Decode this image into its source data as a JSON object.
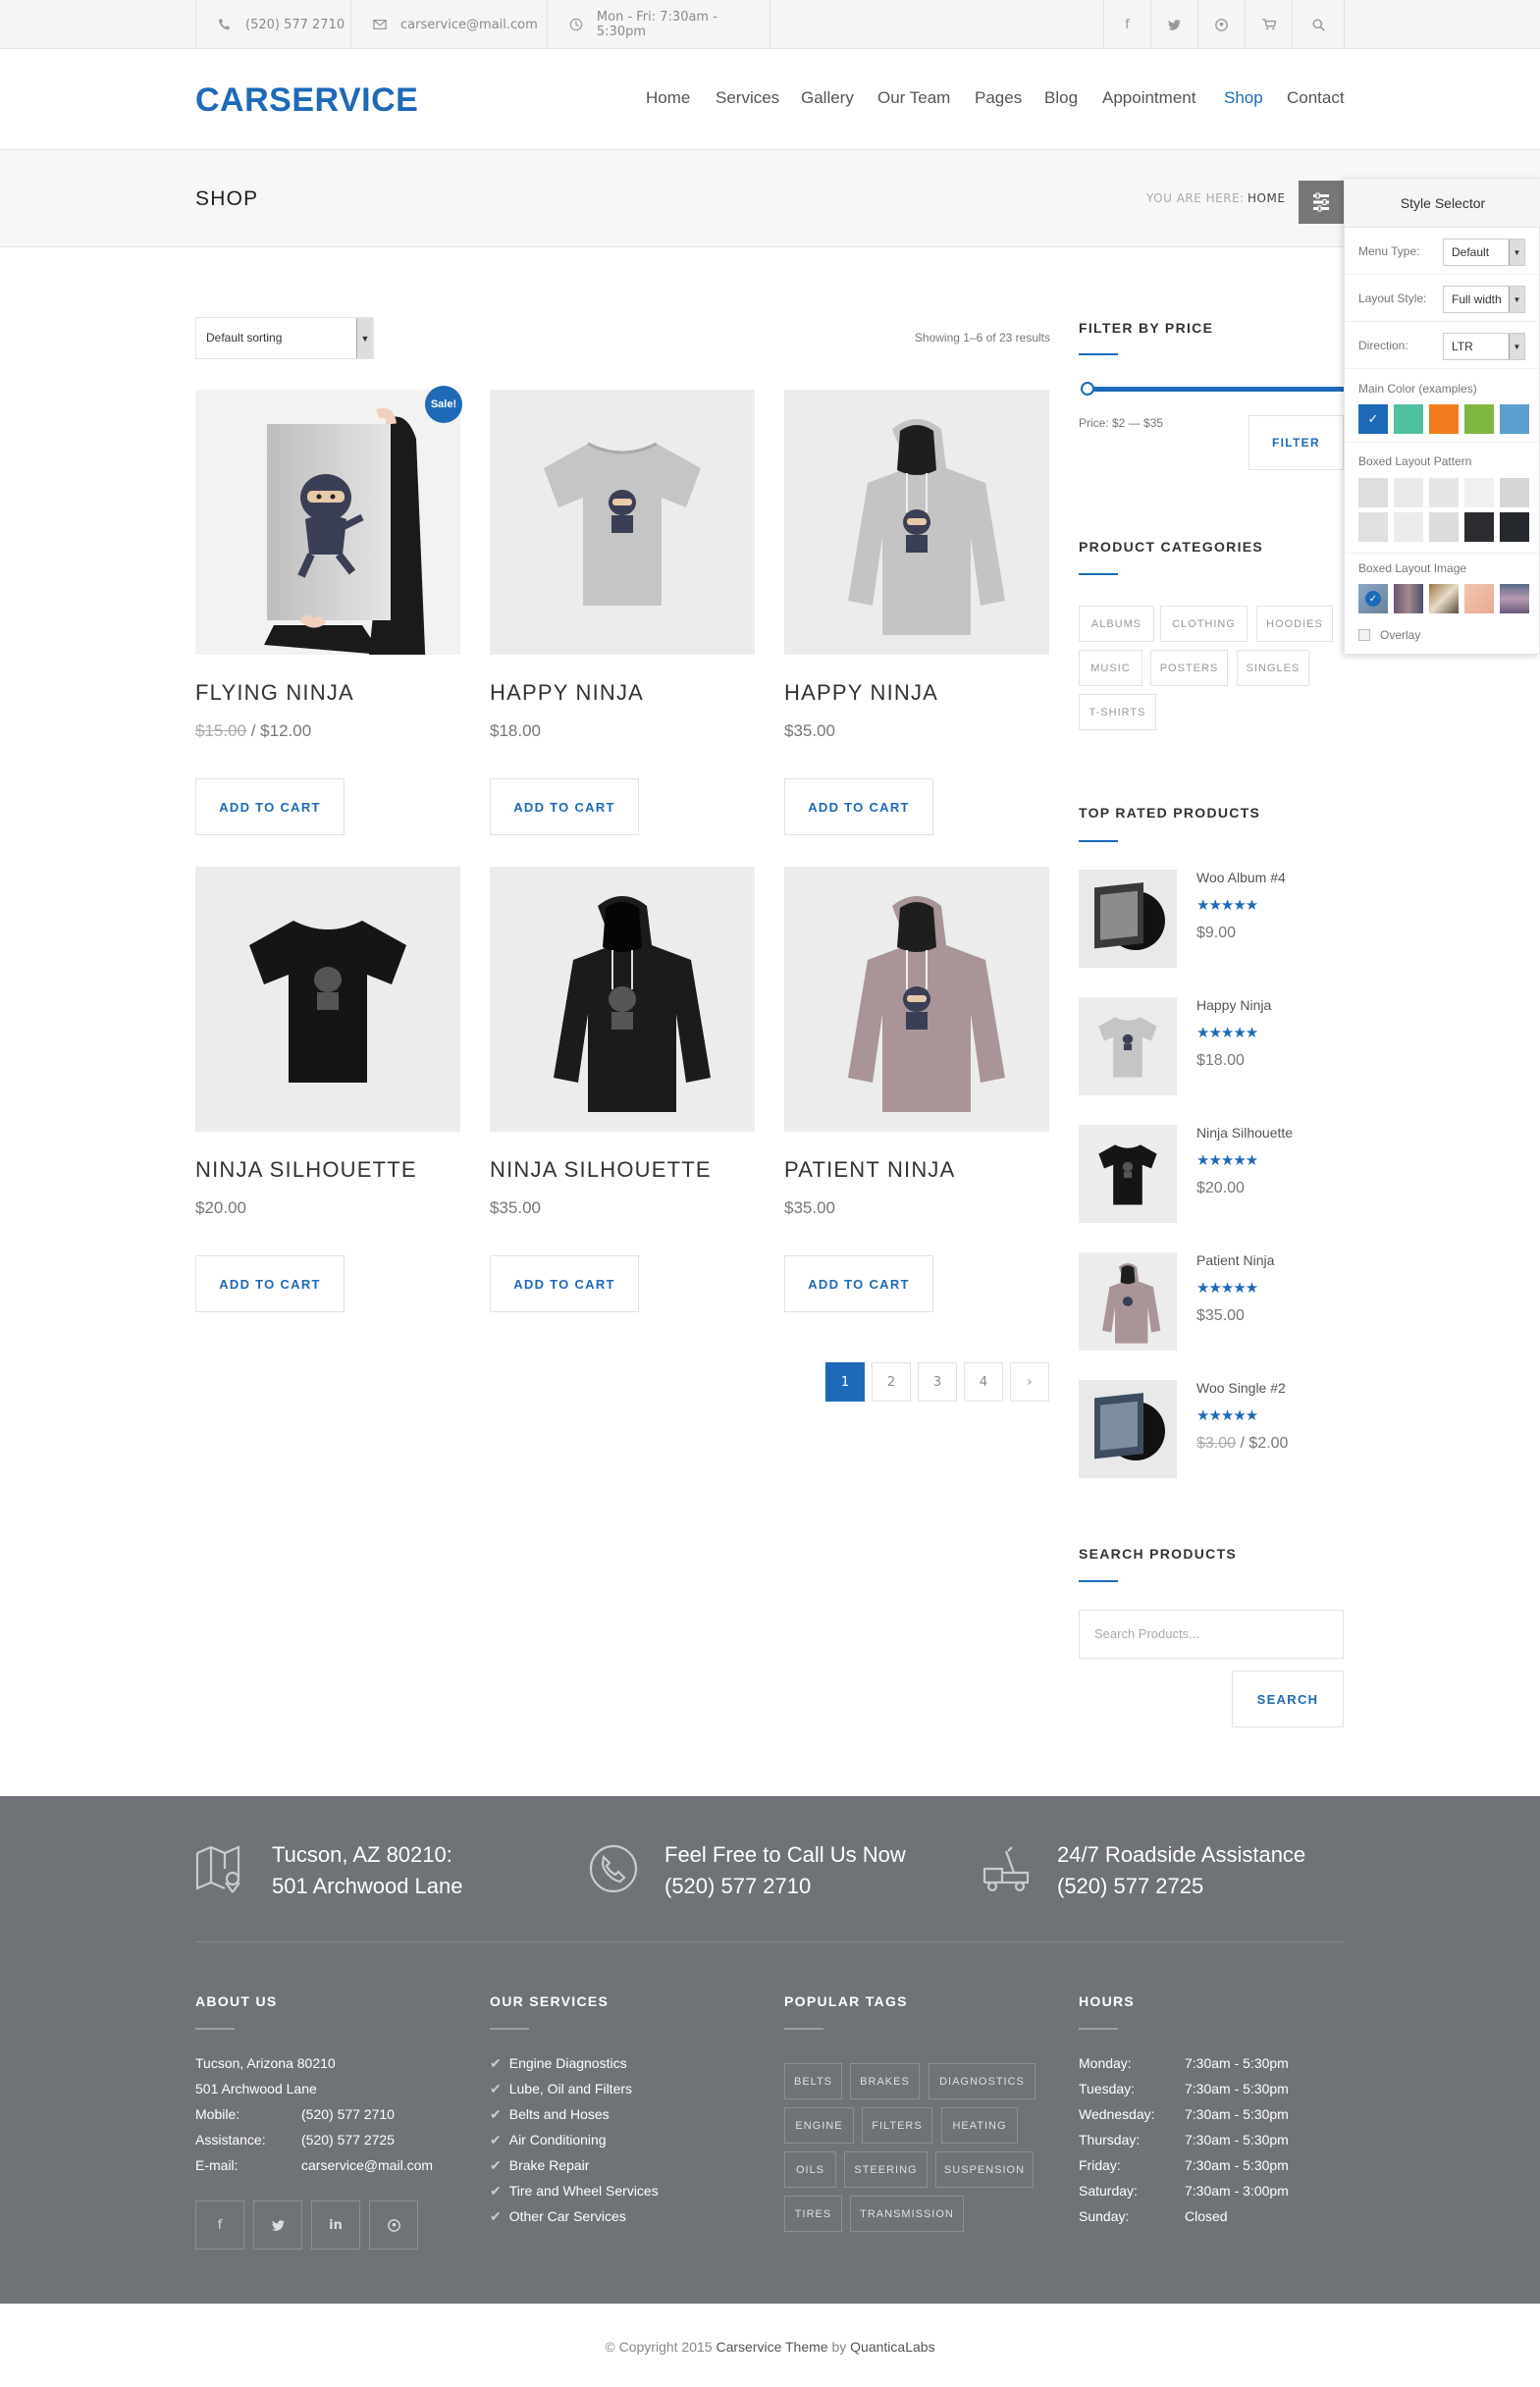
{
  "topbar": {
    "phone": "(520) 577 2710",
    "email": "carservice@mail.com",
    "hours": "Mon - Fri: 7:30am - 5:30pm",
    "social": [
      "f",
      "t",
      "p",
      "cart",
      "search"
    ]
  },
  "header": {
    "logo": "CARSERVICE",
    "nav": [
      "Home",
      "Services",
      "Gallery",
      "Our Team",
      "Pages",
      "Blog",
      "Appointment",
      "Shop",
      "Contact"
    ],
    "active_nav": "Shop"
  },
  "titlebar": {
    "title": "SHOP",
    "breadcrumb_label": "YOU ARE HERE:",
    "breadcrumb_home": "HOME"
  },
  "shop": {
    "sort_label": "Default sorting",
    "result_count": "Showing 1–6 of 23 results",
    "add_to_cart": "ADD TO CART",
    "sale_badge": "Sale!",
    "products": [
      {
        "name": "FLYING NINJA",
        "old_price": "$15.00",
        "price": "$12.00",
        "sale": true,
        "image": "poster"
      },
      {
        "name": "HAPPY NINJA",
        "price": "$18.00",
        "image": "tshirt-grey"
      },
      {
        "name": "HAPPY NINJA",
        "price": "$35.00",
        "image": "hoodie-grey"
      },
      {
        "name": "NINJA SILHOUETTE",
        "price": "$20.00",
        "image": "tshirt-black"
      },
      {
        "name": "NINJA SILHOUETTE",
        "price": "$35.00",
        "image": "hoodie-black"
      },
      {
        "name": "PATIENT NINJA",
        "price": "$35.00",
        "image": "hoodie-pink"
      }
    ],
    "pagination": [
      "1",
      "2",
      "3",
      "4",
      "›"
    ],
    "current_page": "1"
  },
  "sidebar": {
    "filter": {
      "title": "FILTER BY PRICE",
      "price_range": "Price: $2 — $35",
      "button": "FILTER"
    },
    "categories": {
      "title": "PRODUCT CATEGORIES",
      "items": [
        "ALBUMS",
        "CLOTHING",
        "HOODIES",
        "MUSIC",
        "POSTERS",
        "SINGLES",
        "T-SHIRTS"
      ]
    },
    "top_rated": {
      "title": "TOP RATED PRODUCTS",
      "items": [
        {
          "name": "Woo Album #4",
          "price": "$9.00",
          "rating": 5,
          "image": "album"
        },
        {
          "name": "Happy Ninja",
          "price": "$18.00",
          "rating": 5,
          "image": "tshirt-grey"
        },
        {
          "name": "Ninja Silhouette",
          "price": "$20.00",
          "rating": 5,
          "image": "tshirt-black"
        },
        {
          "name": "Patient Ninja",
          "price": "$35.00",
          "rating": 5,
          "image": "hoodie-pink"
        },
        {
          "name": "Woo Single #2",
          "old_price": "$3.00",
          "price": "$2.00",
          "rating": 5,
          "image": "single"
        }
      ]
    },
    "search": {
      "title": "SEARCH PRODUCTS",
      "placeholder": "Search Products...",
      "button": "SEARCH"
    }
  },
  "style_selector": {
    "title": "Style Selector",
    "menu_type_label": "Menu Type:",
    "menu_type_value": "Default",
    "layout_style_label": "Layout Style:",
    "layout_style_value": "Full width",
    "direction_label": "Direction:",
    "direction_value": "LTR",
    "main_color_label": "Main Color (examples)",
    "main_colors": [
      "#1e69b8",
      "#4fc0a0",
      "#f07c1e",
      "#7fb541",
      "#5a9fcf"
    ],
    "pattern_label": "Boxed Layout Pattern",
    "image_label": "Boxed Layout Image",
    "overlay_label": "Overlay"
  },
  "footer": {
    "info": [
      {
        "line1": "Tucson, AZ 80210:",
        "line2": "501 Archwood Lane",
        "icon": "map-icon"
      },
      {
        "line1": "Feel Free to Call Us Now",
        "line2": "(520) 577 2710",
        "icon": "phone-icon"
      },
      {
        "line1": "24/7 Roadside Assistance",
        "line2": "(520) 577 2725",
        "icon": "tow-truck-icon"
      }
    ],
    "about": {
      "title": "ABOUT US",
      "address1": "Tucson, Arizona 80210",
      "address2": "501 Archwood Lane",
      "rows": [
        {
          "label": "Mobile:",
          "value": "(520) 577 2710"
        },
        {
          "label": "Assistance:",
          "value": "(520) 577 2725"
        },
        {
          "label": "E-mail:",
          "value": "carservice@mail.com"
        }
      ]
    },
    "services": {
      "title": "OUR SERVICES",
      "items": [
        "Engine Diagnostics",
        "Lube, Oil and Filters",
        "Belts and Hoses",
        "Air Conditioning",
        "Brake Repair",
        "Tire and Wheel Services",
        "Other Car Services"
      ]
    },
    "tags": {
      "title": "POPULAR TAGS",
      "items": [
        "BELTS",
        "BRAKES",
        "DIAGNOSTICS",
        "ENGINE",
        "FILTERS",
        "HEATING",
        "OILS",
        "STEERING",
        "SUSPENSION",
        "TIRES",
        "TRANSMISSION"
      ]
    },
    "hours": {
      "title": "HOURS",
      "rows": [
        {
          "day": "Monday:",
          "time": "7:30am - 5:30pm"
        },
        {
          "day": "Tuesday:",
          "time": "7:30am - 5:30pm"
        },
        {
          "day": "Wednesday:",
          "time": "7:30am - 5:30pm"
        },
        {
          "day": "Thursday:",
          "time": "7:30am - 5:30pm"
        },
        {
          "day": "Friday:",
          "time": "7:30am - 5:30pm"
        },
        {
          "day": "Saturday:",
          "time": "7:30am - 3:00pm"
        },
        {
          "day": "Sunday:",
          "time": "Closed"
        }
      ]
    },
    "social": [
      "f",
      "t",
      "in",
      "p"
    ]
  },
  "copyright": {
    "prefix": "© Copyright 2015",
    "theme": "Carservice Theme",
    "by": "by",
    "author": "QuanticaLabs"
  },
  "colors": {
    "accent": "#1e69b8",
    "footer_bg": "#6f7276"
  }
}
